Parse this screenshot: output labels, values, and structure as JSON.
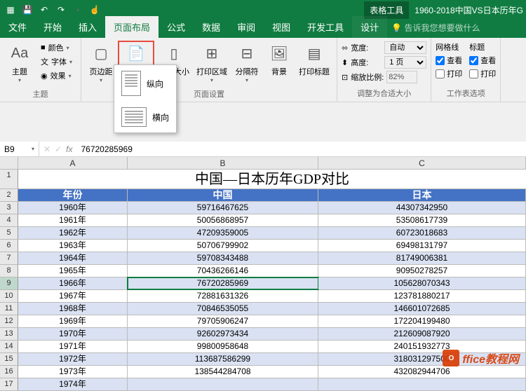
{
  "titlebar": {
    "context_tab": "表格工具",
    "doc_name": "1960-2018中国VS日本历年G"
  },
  "tabs": {
    "file": "文件",
    "home": "开始",
    "insert": "插入",
    "layout": "页面布局",
    "formula": "公式",
    "data": "数据",
    "review": "审阅",
    "view": "视图",
    "dev": "开发工具",
    "design": "设计",
    "tell_me": "告诉我您想要做什么"
  },
  "ribbon": {
    "themes": {
      "label": "主题",
      "main": "主题",
      "colors": "颜色",
      "fonts": "字体",
      "effects": "效果"
    },
    "page_setup": {
      "label": "页面设置",
      "margins": "页边距",
      "orientation": "纸张方向",
      "size": "纸张大小",
      "print_area": "打印区域",
      "breaks": "分隔符",
      "background": "背景",
      "print_titles": "打印标题"
    },
    "scale": {
      "label": "调整为合适大小",
      "width": "宽度:",
      "width_val": "自动",
      "height": "高度:",
      "height_val": "1 页",
      "scale_label": "缩放比例:",
      "scale_val": "82%"
    },
    "sheet_options": {
      "label": "工作表选项",
      "gridlines": "网格线",
      "headings": "标题",
      "view": "查看",
      "print": "打印"
    }
  },
  "dropdown": {
    "portrait": "纵向",
    "landscape": "横向"
  },
  "formula_bar": {
    "name_box": "B9",
    "fx": "fx",
    "value": "76720285969"
  },
  "columns": [
    "A",
    "B",
    "C"
  ],
  "sheet_title": "中国—日本历年GDP对比",
  "headers": [
    "年份",
    "中国",
    "日本"
  ],
  "rows": [
    {
      "n": 3,
      "year": "1960年",
      "china": "59716467625",
      "japan": "44307342950"
    },
    {
      "n": 4,
      "year": "1961年",
      "china": "50056868957",
      "japan": "53508617739"
    },
    {
      "n": 5,
      "year": "1962年",
      "china": "47209359005",
      "japan": "60723018683"
    },
    {
      "n": 6,
      "year": "1963年",
      "china": "50706799902",
      "japan": "69498131797"
    },
    {
      "n": 7,
      "year": "1964年",
      "china": "59708343488",
      "japan": "81749006381"
    },
    {
      "n": 8,
      "year": "1965年",
      "china": "70436266146",
      "japan": "90950278257"
    },
    {
      "n": 9,
      "year": "1966年",
      "china": "76720285969",
      "japan": "105628070343"
    },
    {
      "n": 10,
      "year": "1967年",
      "china": "72881631326",
      "japan": "123781880217"
    },
    {
      "n": 11,
      "year": "1968年",
      "china": "70846535055",
      "japan": "146601072685"
    },
    {
      "n": 12,
      "year": "1969年",
      "china": "79705906247",
      "japan": "172204199480"
    },
    {
      "n": 13,
      "year": "1970年",
      "china": "92602973434",
      "japan": "212609087920"
    },
    {
      "n": 14,
      "year": "1971年",
      "china": "99800958648",
      "japan": "240151932773"
    },
    {
      "n": 15,
      "year": "1972年",
      "china": "113687586299",
      "japan": "318031297500"
    },
    {
      "n": 16,
      "year": "1973年",
      "china": "138544284708",
      "japan": "432082944706"
    },
    {
      "n": 17,
      "year": "1974年",
      "china": "",
      "japan": ""
    }
  ],
  "selected": {
    "row": 9,
    "col": "B"
  },
  "watermark": "ffice教程网"
}
